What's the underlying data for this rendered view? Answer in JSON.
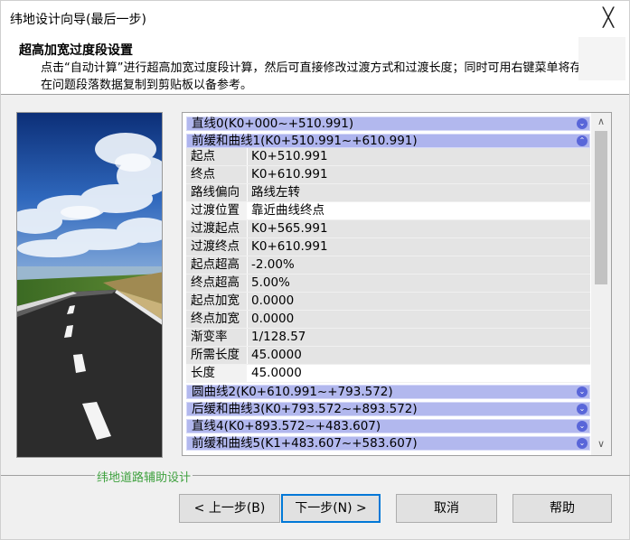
{
  "window": {
    "title": "纬地设计向导(最后一步)",
    "close_glyph": "╳"
  },
  "header": {
    "title": "超高加宽过度段设置",
    "description": "点击“自动计算”进行超高加宽过度段计算，然后可直接修改过渡方式和过渡长度；同时可用右键菜单将存在问题段落数据复制到剪贴板以备参考。"
  },
  "segments": [
    {
      "label": "直线0(K0+000~+510.991)",
      "state": "collapsed"
    },
    {
      "label": "前缓和曲线1(K0+510.991~+610.991)",
      "state": "expanded"
    },
    {
      "label": "圆曲线2(K0+610.991~+793.572)",
      "state": "collapsed"
    },
    {
      "label": "后缓和曲线3(K0+793.572~+893.572)",
      "state": "collapsed"
    },
    {
      "label": "直线4(K0+893.572~+483.607)",
      "state": "collapsed"
    },
    {
      "label": "前缓和曲线5(K1+483.607~+583.607)",
      "state": "collapsed"
    }
  ],
  "properties": [
    {
      "key": "起点",
      "value": "K0+510.991"
    },
    {
      "key": "终点",
      "value": "K0+610.991"
    },
    {
      "key": "路线偏向",
      "value": "路线左转"
    },
    {
      "key": "过渡位置",
      "value": "靠近曲线终点"
    },
    {
      "key": "过渡起点",
      "value": "K0+565.991"
    },
    {
      "key": "过渡终点",
      "value": "K0+610.991"
    },
    {
      "key": "起点超高",
      "value": "-2.00%"
    },
    {
      "key": "终点超高",
      "value": "5.00%"
    },
    {
      "key": "起点加宽",
      "value": "0.0000"
    },
    {
      "key": "终点加宽",
      "value": "0.0000"
    },
    {
      "key": "渐变率",
      "value": "1/128.57"
    },
    {
      "key": "所需长度",
      "value": "45.0000"
    },
    {
      "key": "长度",
      "value": "45.0000"
    }
  ],
  "icons": {
    "collapse": "chevron-up-icon",
    "expand": "chevron-down-icon"
  },
  "brand": "纬地道路辅助设计",
  "buttons": {
    "back": "< 上一步(B)",
    "next": "下一步(N) >",
    "cancel": "取消",
    "help": "帮助"
  },
  "colors": {
    "segment_header": "#b2b8ee",
    "chevron": "#5966d9",
    "brand_text": "#3fa13f",
    "primary_border": "#0078d7"
  }
}
